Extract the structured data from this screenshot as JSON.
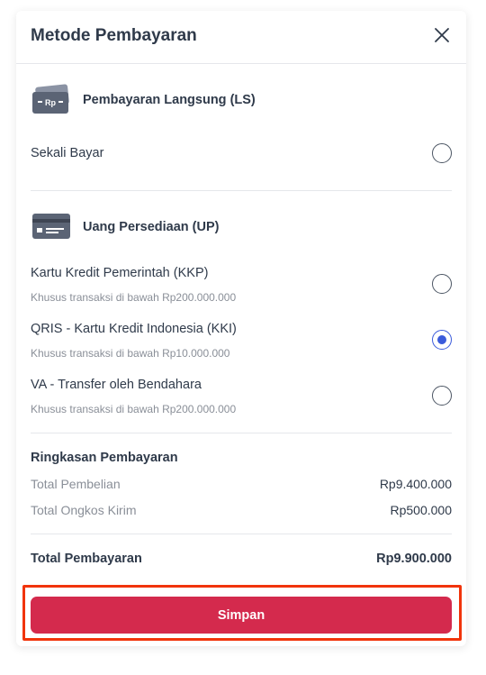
{
  "modal": {
    "title": "Metode Pembayaran"
  },
  "ls_section": {
    "label": "Pembayaran Langsung (LS)",
    "icon_text": "Rp",
    "options": [
      {
        "title": "Sekali Bayar",
        "selected": false
      }
    ]
  },
  "up_section": {
    "label": "Uang Persediaan (UP)",
    "options": [
      {
        "title": "Kartu Kredit Pemerintah (KKP)",
        "subtitle": "Khusus transaksi di bawah Rp200.000.000",
        "selected": false
      },
      {
        "title": "QRIS - Kartu Kredit Indonesia (KKI)",
        "subtitle": "Khusus transaksi di bawah Rp10.000.000",
        "selected": true
      },
      {
        "title": "VA - Transfer oleh Bendahara",
        "subtitle": "Khusus transaksi di bawah Rp200.000.000",
        "selected": false
      }
    ]
  },
  "summary": {
    "title": "Ringkasan Pembayaran",
    "rows": [
      {
        "label": "Total Pembelian",
        "value": "Rp9.400.000"
      },
      {
        "label": "Total Ongkos Kirim",
        "value": "Rp500.000"
      }
    ],
    "total_label": "Total Pembayaran",
    "total_value": "Rp9.900.000"
  },
  "actions": {
    "save_label": "Simpan"
  },
  "colors": {
    "primary_button": "#d42a4d",
    "radio_selected": "#3b5bdb",
    "highlight_border": "#f1340b"
  }
}
